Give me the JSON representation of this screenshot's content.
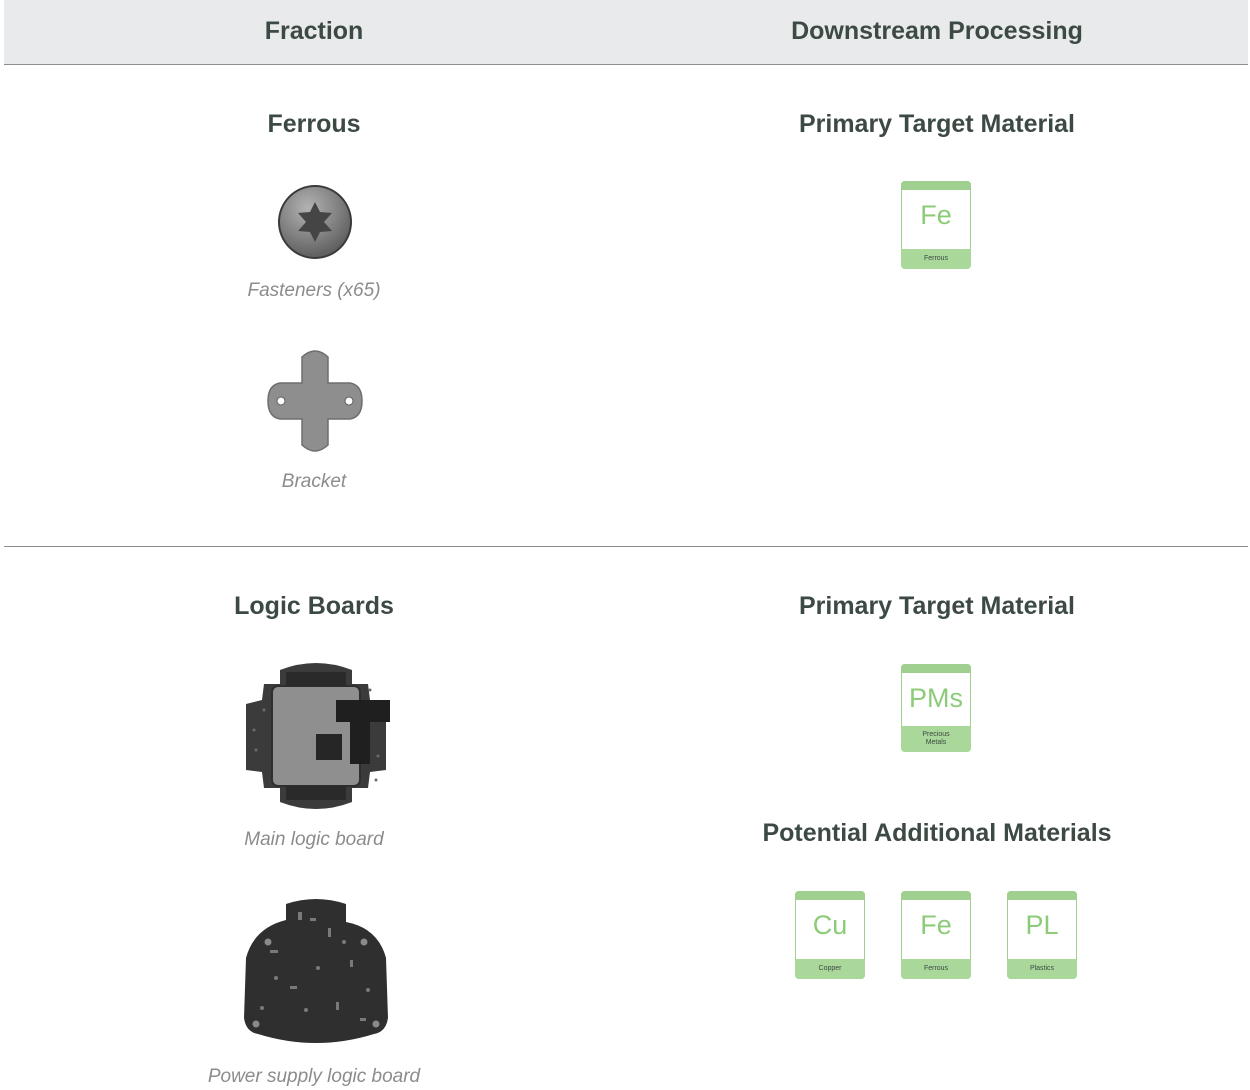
{
  "header": {
    "fraction_label": "Fraction",
    "processing_label": "Downstream Processing"
  },
  "sections": [
    {
      "title": "Ferrous",
      "items": [
        {
          "caption": "Fasteners (x65)",
          "icon": "screw-head-icon"
        },
        {
          "caption": "Bracket",
          "icon": "bracket-icon"
        }
      ],
      "primary_label": "Primary Target Material",
      "primary": [
        {
          "symbol": "Fe",
          "name": "Ferrous"
        }
      ]
    },
    {
      "title": "Logic Boards",
      "items": [
        {
          "caption": "Main logic board",
          "icon": "main-logic-board-icon"
        },
        {
          "caption": "Power supply logic board",
          "icon": "power-supply-board-icon"
        }
      ],
      "primary_label": "Primary Target Material",
      "primary": [
        {
          "symbol": "PMs",
          "name": "Precious Metals"
        }
      ],
      "additional_label": "Potential Additional Materials",
      "additional": [
        {
          "symbol": "Cu",
          "name": "Copper"
        },
        {
          "symbol": "Fe",
          "name": "Ferrous"
        },
        {
          "symbol": "PL",
          "name": "Plastics"
        }
      ]
    }
  ],
  "colors": {
    "heading": "#3d4a44",
    "caption": "#8c8c8c",
    "tile_green": "#9fd08f",
    "header_bg": "#e9eaeb"
  }
}
